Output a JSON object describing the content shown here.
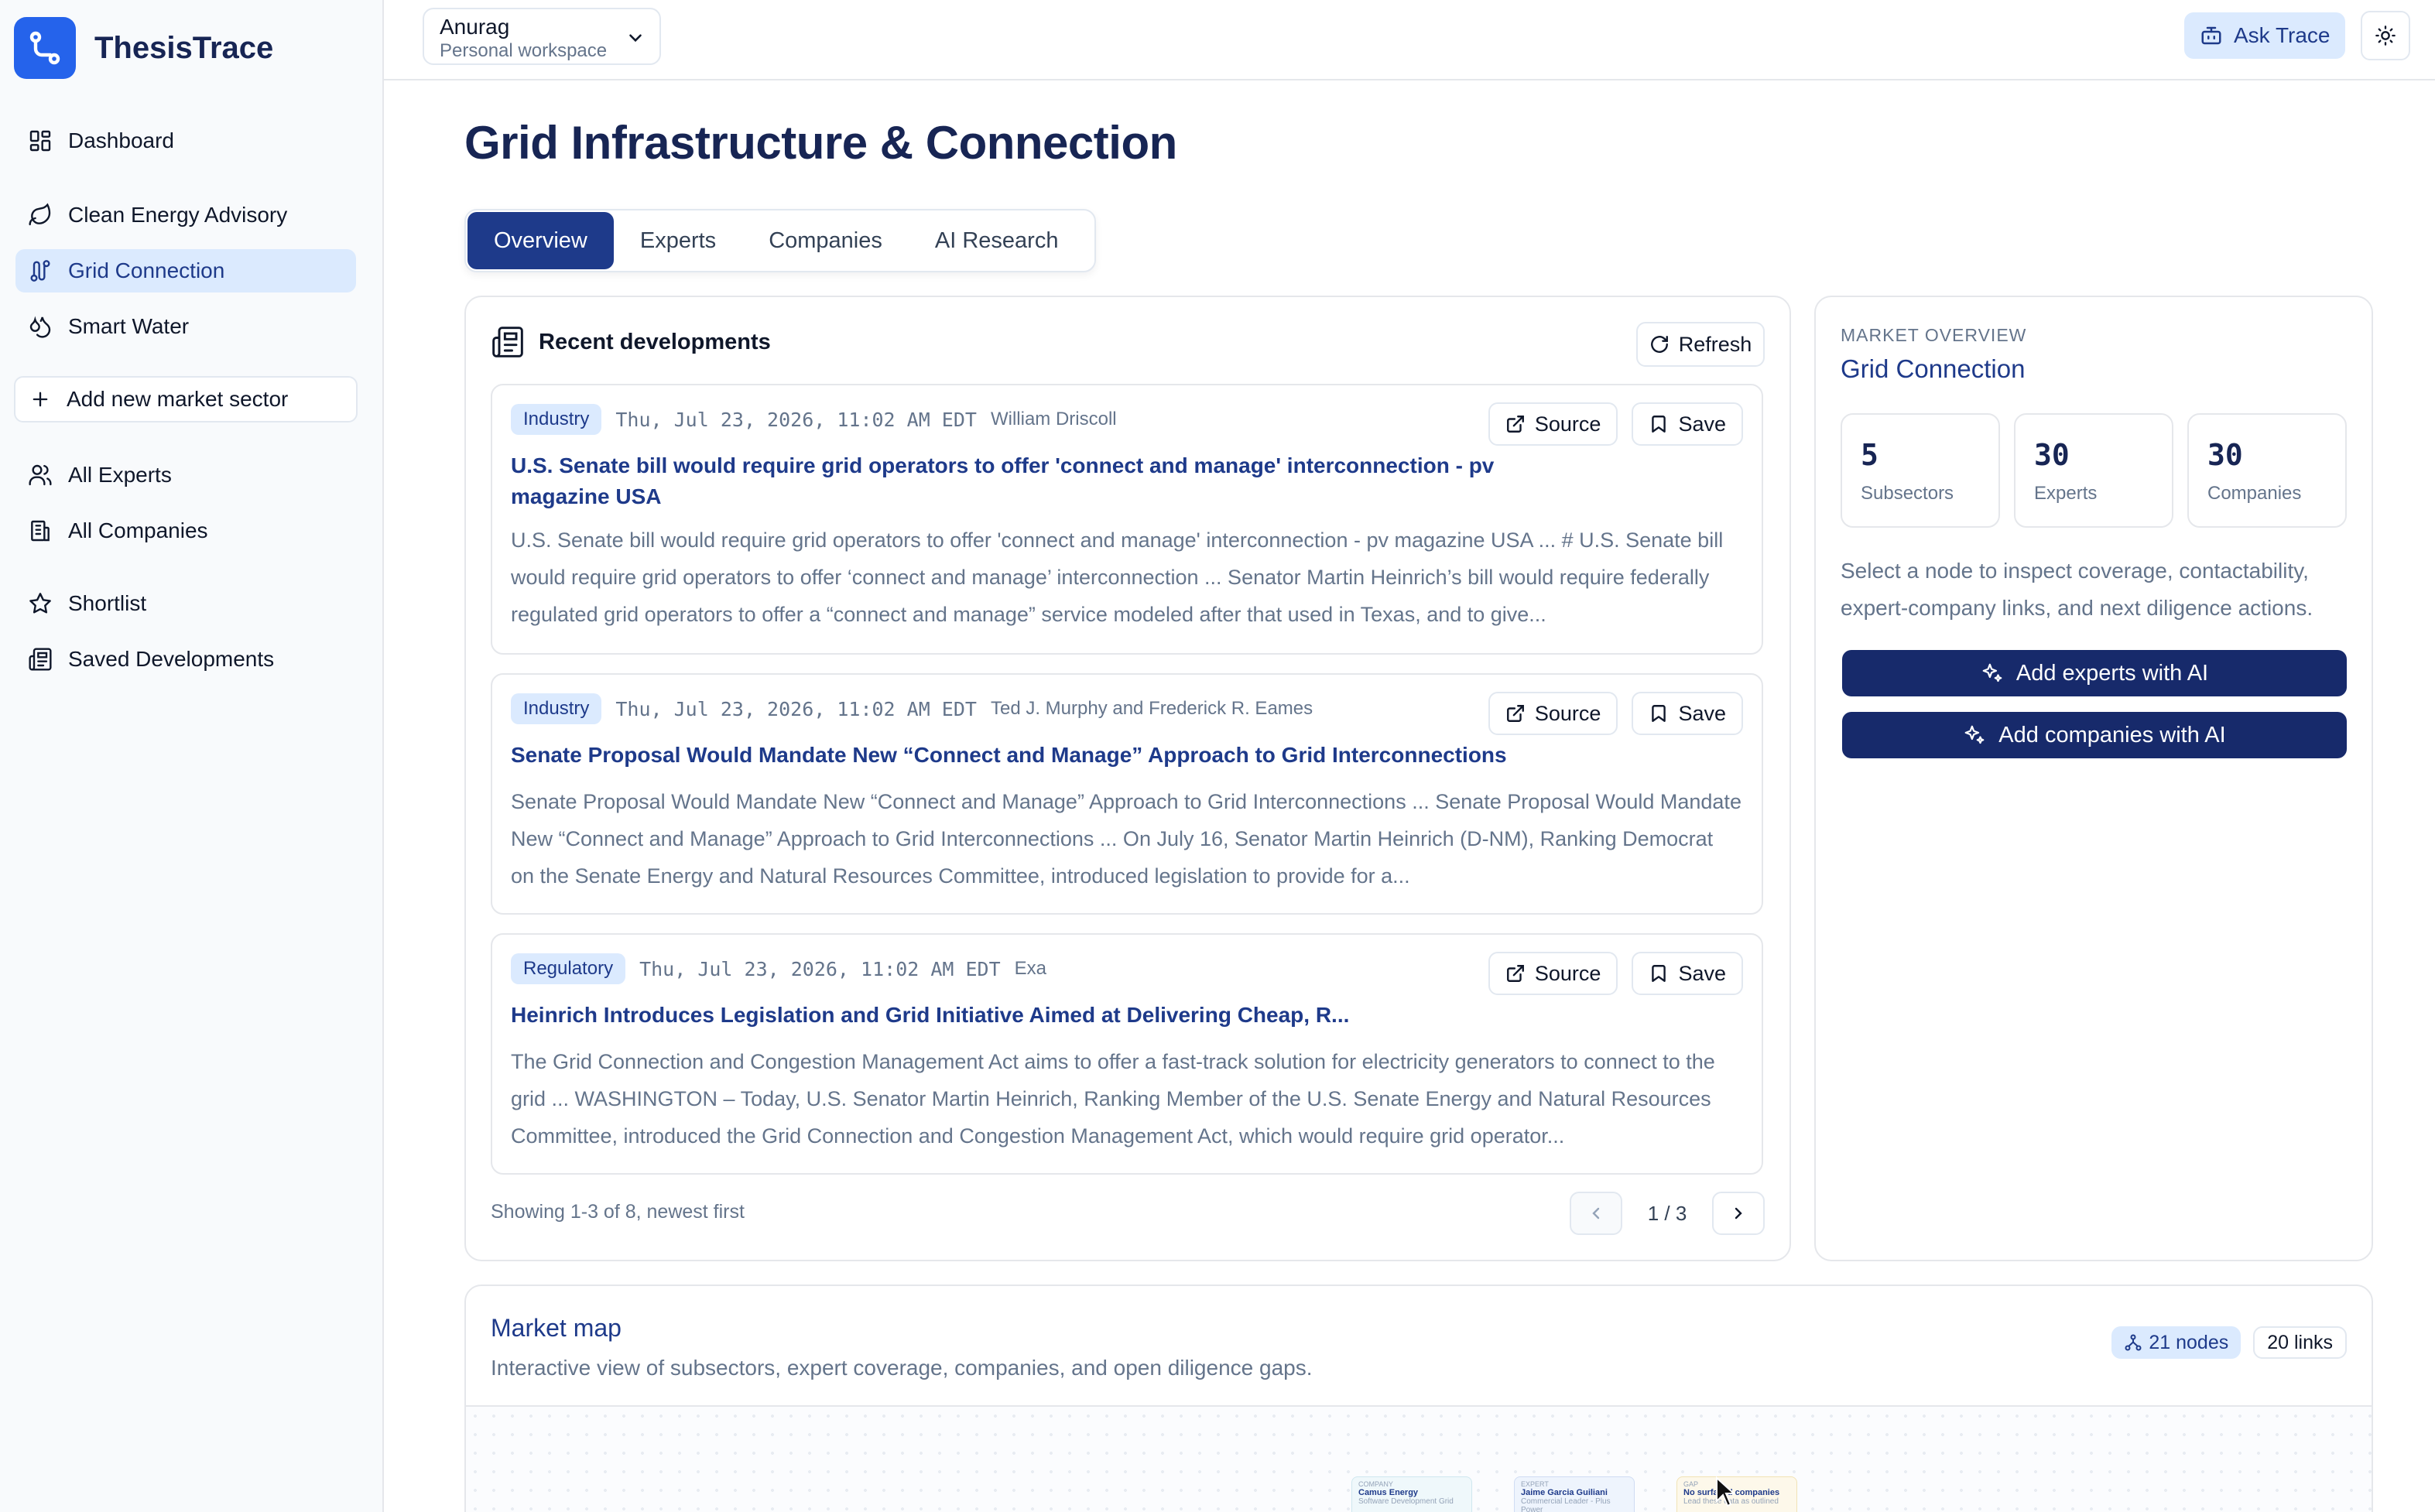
{
  "app": {
    "name": "ThesisTrace"
  },
  "sidebar": {
    "dashboard": "Dashboard",
    "sectors": [
      {
        "label": "Clean Energy Advisory",
        "icon": "leaf-icon"
      },
      {
        "label": "Grid Connection",
        "icon": "route-icon",
        "active": true
      },
      {
        "label": "Smart Water",
        "icon": "droplets-icon"
      }
    ],
    "add_sector": "Add new market sector",
    "all_experts": "All Experts",
    "all_companies": "All Companies",
    "shortlist": "Shortlist",
    "saved_developments": "Saved Developments"
  },
  "header": {
    "workspace_name": "Anurag",
    "workspace_type": "Personal workspace",
    "ask_trace": "Ask Trace"
  },
  "page": {
    "title": "Grid Infrastructure & Connection",
    "tabs": [
      "Overview",
      "Experts",
      "Companies",
      "AI Research"
    ],
    "active_tab": "Overview"
  },
  "developments": {
    "heading": "Recent developments",
    "refresh": "Refresh",
    "source_label": "Source",
    "save_label": "Save",
    "items": [
      {
        "tag": "Industry",
        "date": "Thu, Jul 23, 2026, 11:02 AM EDT",
        "author": "William Driscoll",
        "title": "U.S. Senate bill would require grid operators to offer 'connect and manage' interconnection - pv magazine USA",
        "body": "U.S. Senate bill would require grid operators to offer 'connect and manage' interconnection - pv magazine USA ... # U.S. Senate bill would require grid operators to offer ‘connect and manage’ interconnection ... Senator Martin Heinrich’s bill would require federally regulated grid operators to offer a “connect and manage” service modeled after that used in Texas, and to give..."
      },
      {
        "tag": "Industry",
        "date": "Thu, Jul 23, 2026, 11:02 AM EDT",
        "author": "Ted J. Murphy and Frederick R. Eames",
        "title": "Senate Proposal Would Mandate New “Connect and Manage” Approach to Grid Interconnections",
        "body": "Senate Proposal Would Mandate New “Connect and Manage” Approach to Grid Interconnections ... Senate Proposal Would Mandate New “Connect and Manage” Approach to Grid Interconnections ... On July 16, Senator Martin Heinrich (D-NM), Ranking Democrat on the Senate Energy and Natural Resources Committee, introduced legislation to provide for a..."
      },
      {
        "tag": "Regulatory",
        "date": "Thu, Jul 23, 2026, 11:02 AM EDT",
        "author": "Exa",
        "title": "Heinrich Introduces Legislation and Grid Initiative Aimed at Delivering Cheap, R...",
        "body": "The Grid Connection and Congestion Management Act aims to offer a fast-track solution for electricity generators to connect to the grid ... WASHINGTON – Today, U.S. Senator Martin Heinrich, Ranking Member of the U.S. Senate Energy and Natural Resources Committee, introduced the Grid Connection and Congestion Management Act, which would require grid operator..."
      }
    ],
    "footer": "Showing 1-3 of 8, newest first",
    "page_indicator": "1 / 3"
  },
  "overview": {
    "label": "MARKET OVERVIEW",
    "title": "Grid Connection",
    "stats": [
      {
        "value": "5",
        "label": "Subsectors"
      },
      {
        "value": "30",
        "label": "Experts"
      },
      {
        "value": "30",
        "label": "Companies"
      }
    ],
    "description": "Select a node to inspect coverage, contactability, expert-company links, and next diligence actions.",
    "add_experts": "Add experts with AI",
    "add_companies": "Add companies with AI"
  },
  "market_map": {
    "title": "Market map",
    "subtitle": "Interactive view of subsectors, expert coverage, companies, and open diligence gaps.",
    "nodes_chip": "21 nodes",
    "links_chip": "20 links",
    "nodes": [
      {
        "kind": "COMPANY",
        "name": "Camus Energy",
        "sub": "Software Development Grid"
      },
      {
        "kind": "EXPERT",
        "name": "Jaime Garcia Guiliani",
        "sub": "Commercial Leader - Plus Power"
      },
      {
        "kind": "GAP",
        "name": "No surfaced companies",
        "sub": "Lead these data as outlined"
      }
    ]
  },
  "colors": {
    "brand": "#2563eb",
    "navy": "#1e3a8a",
    "active_bg": "#dbeafe",
    "button_dark": "#172a6b",
    "muted_text": "#64748b"
  }
}
